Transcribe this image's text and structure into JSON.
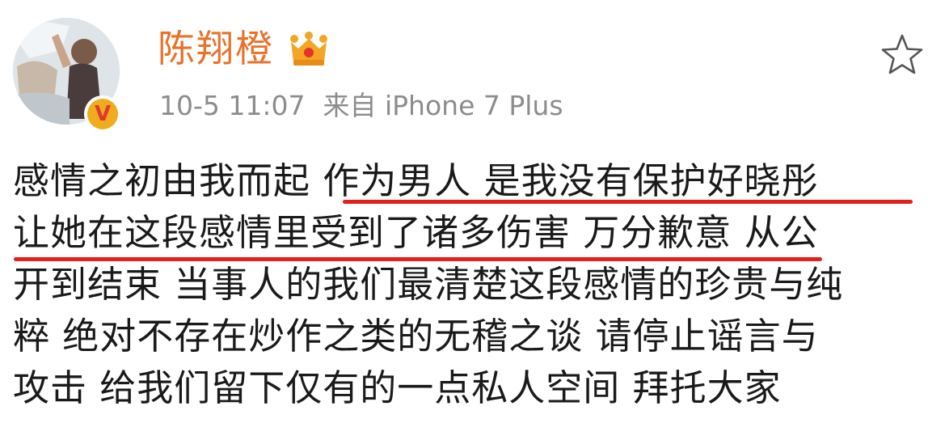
{
  "post": {
    "username": "陈翔橙",
    "timestamp": "10-5 11:07",
    "source": "来自 iPhone 7 Plus",
    "lines": [
      "感情之初由我而起 作为男人 是我没有保护好晓彤",
      "让她在这段感情里受到了诸多伤害 万分歉意 从公",
      "开到结束 当事人的我们最清楚这段感情的珍贵与纯",
      "粹 绝对不存在炒作之类的无稽之谈 请停止谣言与",
      "攻击 给我们留下仅有的一点私人空间 拜托大家"
    ]
  },
  "colors": {
    "username": "#e8722a",
    "meta": "#8c8c8c",
    "underline": "#e3201b",
    "verified_badge": "#f0ac1e"
  },
  "icons": {
    "crown": "crown-icon",
    "verified": "verified-icon",
    "favorite": "star-icon"
  }
}
